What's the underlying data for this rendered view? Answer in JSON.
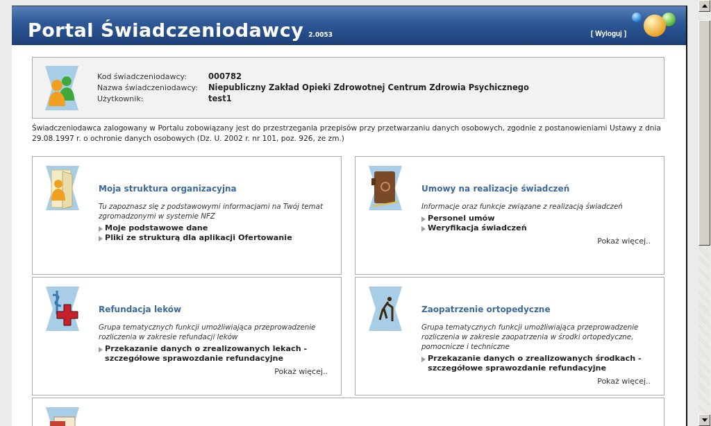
{
  "header": {
    "title": "Portal Świadczeniodawcy",
    "version": "2.0053",
    "logout": "[ Wyloguj ]"
  },
  "provider": [
    {
      "label": "Kod świadczeniodawcy:",
      "value": "000782"
    },
    {
      "label": "Nazwa świadczeniodawcy:",
      "value": "Niepubliczny Zakład Opieki Zdrowotnej Centrum Zdrowia Psychicznego"
    },
    {
      "label": "Użytkownik:",
      "value": "test1"
    }
  ],
  "notice": "Świadczeniodawca zalogowany w Portalu zobowiązany jest do przestrzegania przepisów przy przetwarzaniu danych osobowych, zgodnie z postanowieniami Ustawy z dnia 29.08.1997 r. o ochronie danych osobowych (Dz. U. 2002 r. nr 101, poz. 926, ze zm.)",
  "sections": [
    {
      "title": "Moja struktura organizacyjna",
      "description": "Tu zapoznasz się z podstawowymi informacjami na Twój temat zgromadzonymi w systemie NFZ",
      "links": [
        "Moje podstawowe dane",
        "Pliki ze strukturą dla aplikacji Ofertowanie"
      ]
    },
    {
      "title": "Umowy na realizacje świadczeń",
      "description": "Informacje oraz funkcje związane z realizacją świadczeń",
      "links": [
        "Personel umów",
        "Weryfikacja świadczeń"
      ],
      "more": "Pokaż więcej.."
    },
    {
      "title": "Refundacja leków",
      "description": "Grupa tematycznych funkcji umożliwiająca przeprowadzenie rozliczenia w zakresie refundacji leków",
      "links": [
        "Przekazanie danych o zrealizowanych lekach - szczegółowe sprawozdanie refundacyjne"
      ],
      "more": "Pokaż więcej.."
    },
    {
      "title": "Zaopatrzenie ortopedyczne",
      "description": "Grupa tematycznych funkcji umożliwiająca przeprowadzenie rozliczenia w zakresie zaopatrzenia w środki ortopedyczne, pomocnicze i techniczne",
      "links": [
        "Przekazanie danych o zrealizowanych środkach - szczegółowe sprawozdanie refundacyjne"
      ],
      "more": "Pokaż więcej.."
    },
    {
      "kind": "document"
    }
  ]
}
